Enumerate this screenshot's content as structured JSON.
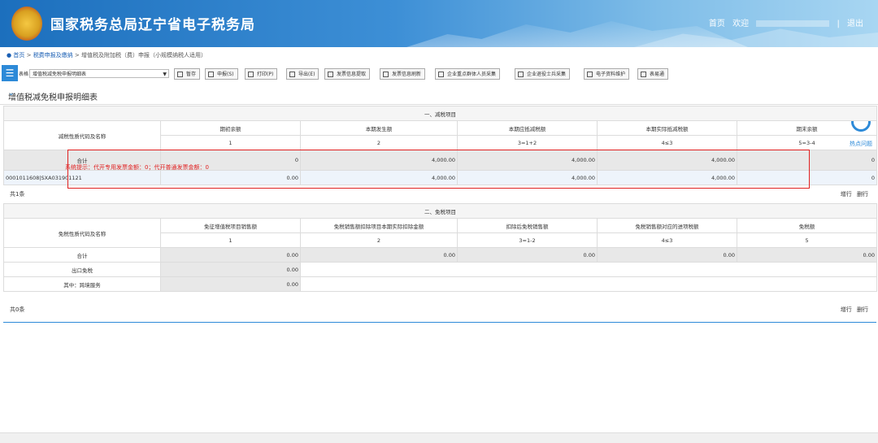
{
  "header": {
    "title": "国家税务总局辽宁省电子税务局",
    "nav_home": "首页",
    "nav_welcome": "欢迎",
    "nav_user": "",
    "nav_separator": "|",
    "nav_logout": "退出"
  },
  "breadcrumb": {
    "home": "首页",
    "sep1": ">",
    "level1": "税费申报及缴纳",
    "sep2": ">",
    "level2": "增值税及附加税（费）申报（小规模纳税人适用）"
  },
  "toolbar": {
    "menu_icon": "☰",
    "form_label": "表格：",
    "form_selected": "增值税减免税申报明细表",
    "buttons": [
      "暂存",
      "申报(S)",
      "打印(P)",
      "导出(E)",
      "发票信息提取",
      "发票信息刷新",
      "企业重点群体人员采集",
      "企业退役士兵采集",
      "电子资料维护",
      "表易通"
    ]
  },
  "section_title": "增值税减免税申报明细表",
  "hot_issue_label": "热点问题",
  "reduce": {
    "section": "一、减税项目",
    "label_col": "减税性质代码及名称",
    "headers": [
      "期初余额",
      "本期发生额",
      "本期应抵减税额",
      "本期实际抵减税额",
      "期末余额"
    ],
    "formulas": [
      "1",
      "2",
      "3=1+2",
      "4≤3",
      "5=3-4"
    ],
    "total_label": "合计",
    "total_values": [
      "0",
      "4,000.00",
      "4,000.00",
      "4,000.00",
      "0"
    ],
    "row_code": "0001011608|SXA031901121",
    "row_values": [
      "0.00",
      "4,000.00",
      "4,000.00",
      "4,000.00",
      "0"
    ],
    "hint": "系统提示：代开专用发票金额：0；代开普通发票金额：0",
    "pager": "共1条",
    "add_row": "增行",
    "del_row": "删行"
  },
  "exempt": {
    "section": "二、免税项目",
    "label_col": "免税性质代码及名称",
    "headers": [
      "免征增值税项目销售额",
      "免税销售额扣除项目本期实际扣除金额",
      "扣除后免税销售额",
      "免税销售额对应的进项税额",
      "免税额"
    ],
    "formulas": [
      "1",
      "2",
      "3=1-2",
      "4≤3",
      "5"
    ],
    "total_label": "合计",
    "total_values": [
      "0.00",
      "0.00",
      "0.00",
      "0.00",
      "0.00"
    ],
    "export_label": "出口免税",
    "export_value": "0.00",
    "cross_label": "其中：跨境服务",
    "cross_value": "0.00",
    "pager": "共0条",
    "add_row": "增行",
    "del_row": "删行"
  }
}
